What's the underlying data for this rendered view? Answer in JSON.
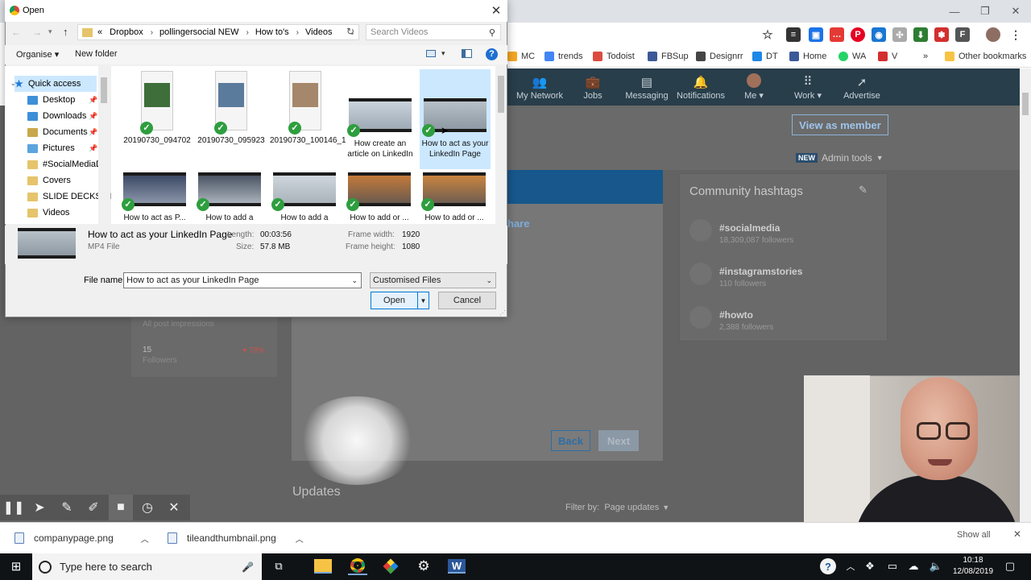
{
  "chrome": {
    "bookmarks": [
      {
        "label": "MC",
        "color": "#f5a623"
      },
      {
        "label": "trends",
        "color": "#4285f4"
      },
      {
        "label": "Todoist",
        "color": "#db4c3f"
      },
      {
        "label": "FBSup",
        "color": "#3b5998"
      },
      {
        "label": "Designrr",
        "color": "#444444"
      },
      {
        "label": "DT",
        "color": "#1e88e5"
      },
      {
        "label": "Home",
        "color": "#3b5998"
      },
      {
        "label": "WA",
        "color": "#25d366"
      },
      {
        "label": "V",
        "color": "#d32f2f"
      },
      {
        "label": "»",
        "color": ""
      },
      {
        "label": "Other bookmarks",
        "color": "#f6c344"
      }
    ]
  },
  "linkedin": {
    "nav": [
      {
        "label": "My Network",
        "icon": "people-icon"
      },
      {
        "label": "Jobs",
        "icon": "briefcase-icon"
      },
      {
        "label": "Messaging",
        "icon": "chat-icon"
      },
      {
        "label": "Notifications",
        "icon": "bell-icon"
      },
      {
        "label": "Me ▾",
        "icon": "avatar"
      },
      {
        "label": "Work ▾",
        "icon": "grid-icon"
      },
      {
        "label": "Advertise",
        "icon": "compass-icon"
      }
    ],
    "view_member": "View as member",
    "new_badge": "NEW",
    "admin_tools": "Admin tools",
    "share_text": "hare",
    "back": "Back",
    "next": "Next",
    "community": {
      "title": "Community hashtags",
      "tags": [
        {
          "name": "#socialmedia",
          "followers": "18,309,087 followers"
        },
        {
          "name": "#instagramstories",
          "followers": "110 followers"
        },
        {
          "name": "#howto",
          "followers": "2,388 followers"
        }
      ]
    },
    "stats": {
      "impressions_label": "All post impressions",
      "followers_value": "15",
      "followers_label": "Followers",
      "followers_change": "▾ 78%"
    },
    "updates_title": "Updates",
    "filter_by": "Filter by:",
    "filter_value": "Page updates"
  },
  "dialog": {
    "title": "Open",
    "breadcrumbs": [
      "«",
      "Dropbox",
      "pollingersocial NEW",
      "How to's",
      "Videos"
    ],
    "search_placeholder": "Search Videos",
    "organise": "Organise ▾",
    "new_folder": "New folder",
    "nav_items": [
      {
        "label": "Quick access",
        "color": "#1e78d7",
        "pinned": false
      },
      {
        "label": "Desktop",
        "color": "#3d8fd9",
        "pinned": true
      },
      {
        "label": "Downloads",
        "color": "#3d8fd9",
        "pinned": true
      },
      {
        "label": "Documents",
        "color": "#c9a74c",
        "pinned": true
      },
      {
        "label": "Pictures",
        "color": "#5ba4de",
        "pinned": true
      },
      {
        "label": "#SocialMediaDa",
        "color": "#e5c46b",
        "pinned": false
      },
      {
        "label": "Covers",
        "color": "#e5c46b",
        "pinned": false
      },
      {
        "label": "SLIDE DECKS NE",
        "color": "#e5c46b",
        "pinned": false
      },
      {
        "label": "Videos",
        "color": "#e5c46b",
        "pinned": false
      }
    ],
    "files": [
      {
        "name": "20190730_094702",
        "kind": "phone",
        "selected": false
      },
      {
        "name": "20190730_095923",
        "kind": "phone",
        "selected": false
      },
      {
        "name": "20190730_100146_1",
        "kind": "phone",
        "selected": false
      },
      {
        "name": "How create an article on LinkedIn",
        "kind": "video",
        "selected": false
      },
      {
        "name": "How to act as your LinkedIn Page",
        "kind": "video",
        "selected": true
      },
      {
        "name": "How to act as P...",
        "kind": "video",
        "selected": false
      },
      {
        "name": "How to add a LinkedIn Profil...",
        "kind": "video",
        "selected": false
      },
      {
        "name": "How to add a Social A Point...",
        "kind": "video",
        "selected": false
      },
      {
        "name": "How to add or ...",
        "kind": "video",
        "selected": false
      },
      {
        "name": "How to add or ...",
        "kind": "video",
        "selected": false
      }
    ],
    "details": {
      "name": "How to act as your LinkedIn Page",
      "type": "MP4 File",
      "length_label": "Length:",
      "length": "00:03:56",
      "size_label": "Size:",
      "size": "57.8 MB",
      "frame_width_label": "Frame width:",
      "frame_width": "1920",
      "frame_height_label": "Frame height:",
      "frame_height": "1080"
    },
    "filename_label": "File name:",
    "filename_value": "How to act as your LinkedIn Page",
    "filter_value": "Customised Files",
    "open": "Open",
    "cancel": "Cancel"
  },
  "downloads": [
    {
      "name": "companypage.png"
    },
    {
      "name": "tileandthumbnail.png"
    }
  ],
  "downloads_show_all": "Show all",
  "taskbar": {
    "search_placeholder": "Type here to search",
    "time": "10:18",
    "date": "12/08/2019"
  }
}
